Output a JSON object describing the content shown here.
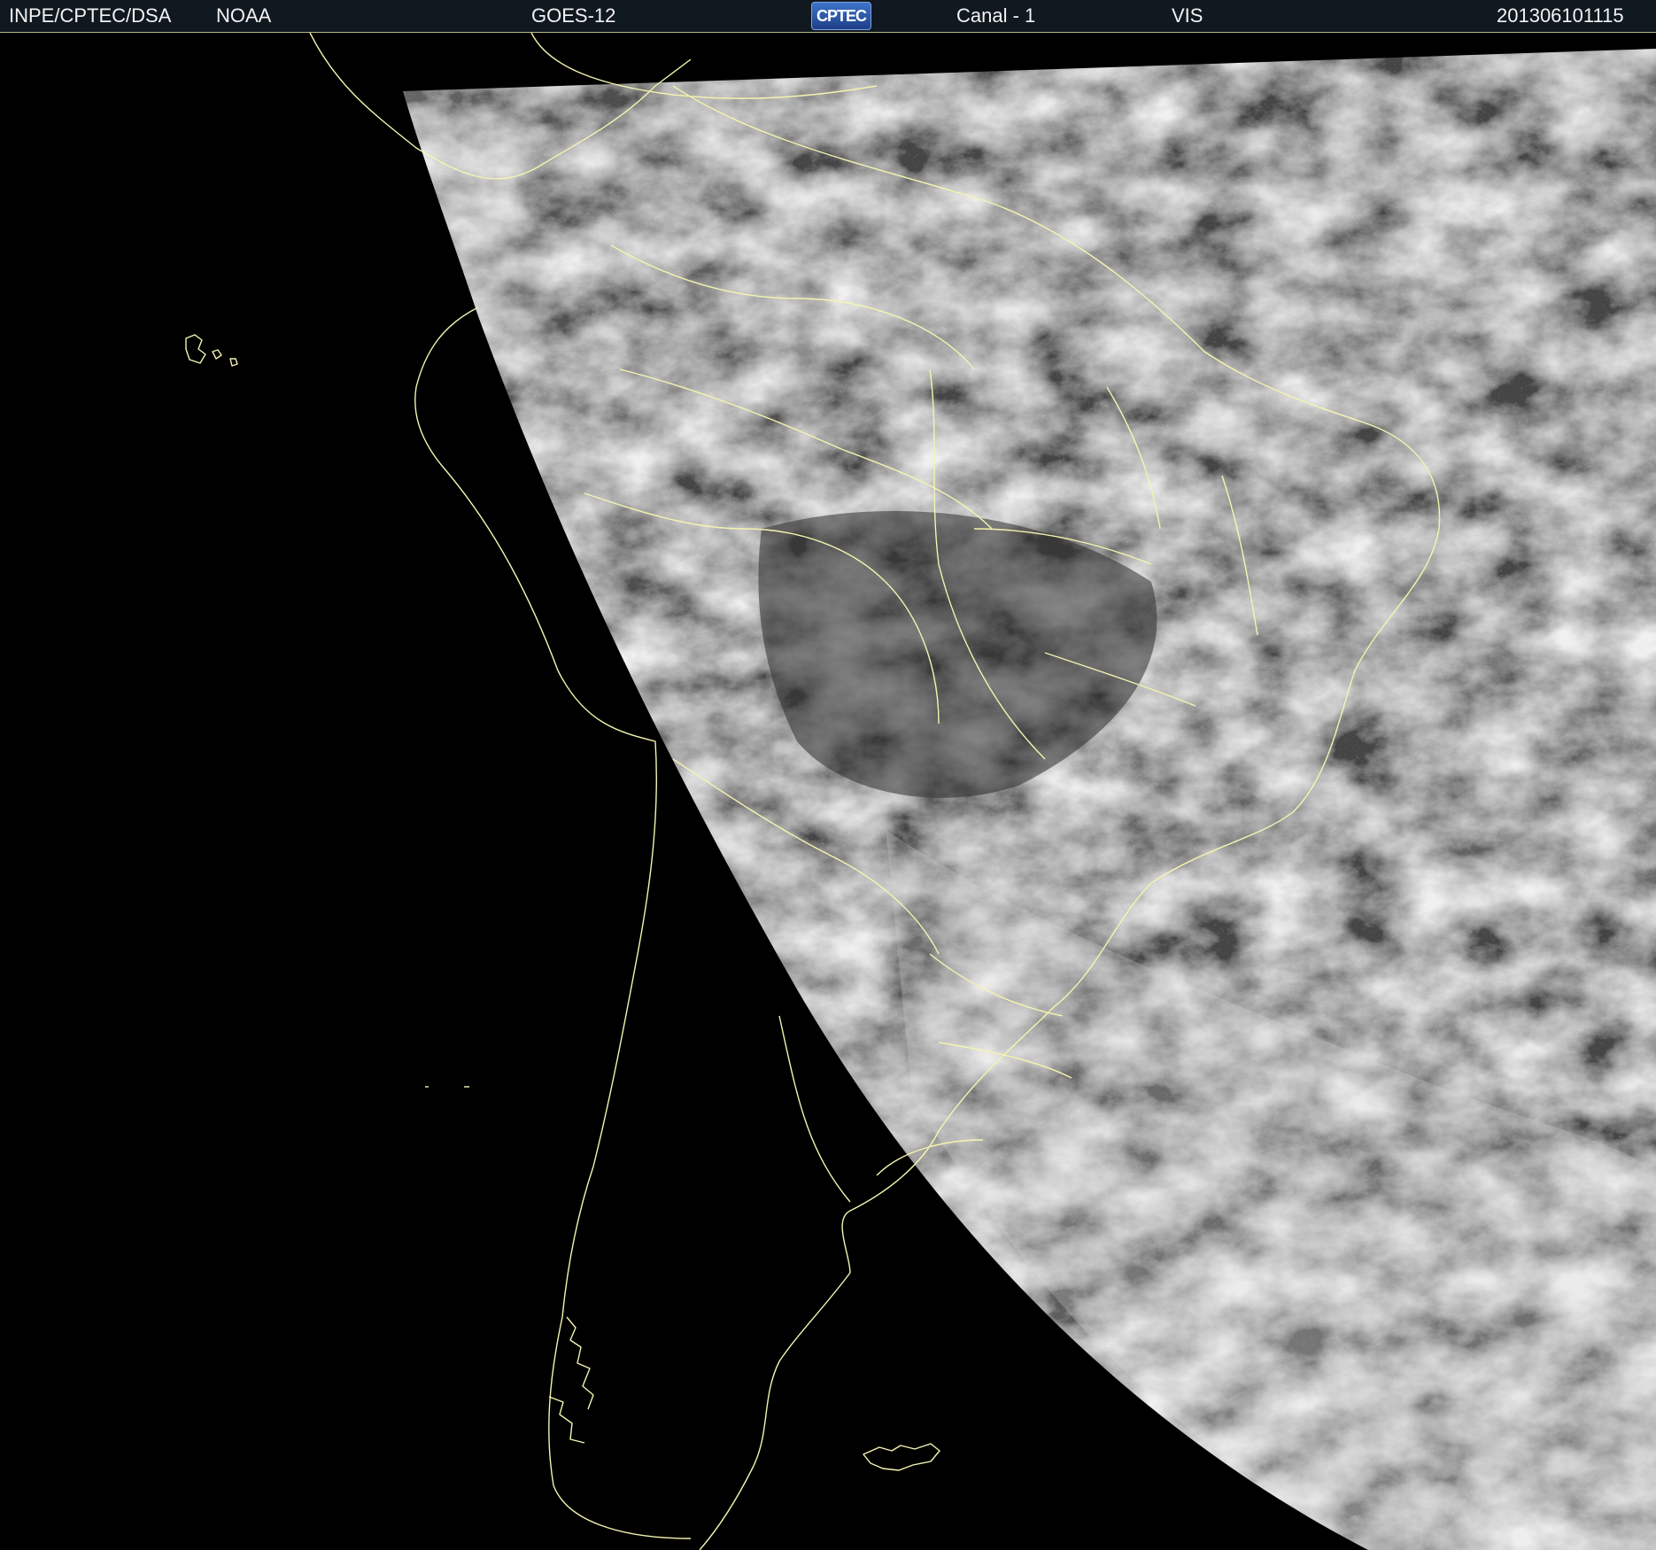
{
  "header": {
    "organization": "INPE/CPTEC/DSA",
    "agency": "NOAA",
    "satellite": "GOES-12",
    "logo_text": "CPTEC",
    "channel": "Canal - 1",
    "band": "VIS",
    "timestamp": "201306101115"
  },
  "colors": {
    "background": "#000000",
    "header_bg": "#101820",
    "border_lines": "#f4f4b0",
    "cloud_gray": "#4a4a4a"
  },
  "map": {
    "projection": "satellite scan, South America view",
    "layers": [
      "satellite-visible-imagery",
      "coastlines",
      "country-borders",
      "state-borders"
    ]
  }
}
